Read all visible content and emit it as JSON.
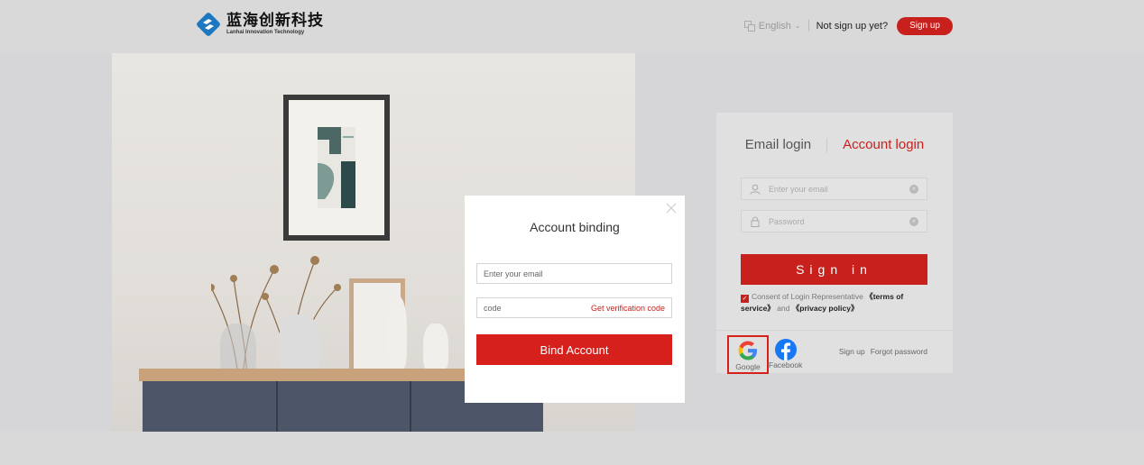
{
  "header": {
    "logo_cn": "蓝海创新科技",
    "logo_en": "Lanhai Innovation Technology",
    "language": "English",
    "not_signed_up": "Not sign up yet?",
    "signup_label": "Sign up"
  },
  "login": {
    "tabs": [
      "Email login",
      "Account login"
    ],
    "active_tab": "Account login",
    "email_placeholder": "Enter your email",
    "password_placeholder": "Password",
    "signin_label": "Sign in",
    "consent_prefix": "Consent of Login Representative",
    "terms": "《terms of service》",
    "and": "and",
    "privacy": "《privacy policy》",
    "consent_checked": true,
    "social": [
      {
        "name": "Google",
        "icon": "google-icon"
      },
      {
        "name": "Facebook",
        "icon": "facebook-icon"
      }
    ],
    "links": [
      "Sign up",
      "Forgot password"
    ]
  },
  "dialog": {
    "title": "Account binding",
    "email_placeholder": "Enter your email",
    "code_placeholder": "code",
    "get_code": "Get verification code",
    "bind_label": "Bind Account"
  },
  "colors": {
    "accent": "#c8201c",
    "header_bg": "#d9d9da",
    "panel_bg": "#e0e0e1"
  }
}
